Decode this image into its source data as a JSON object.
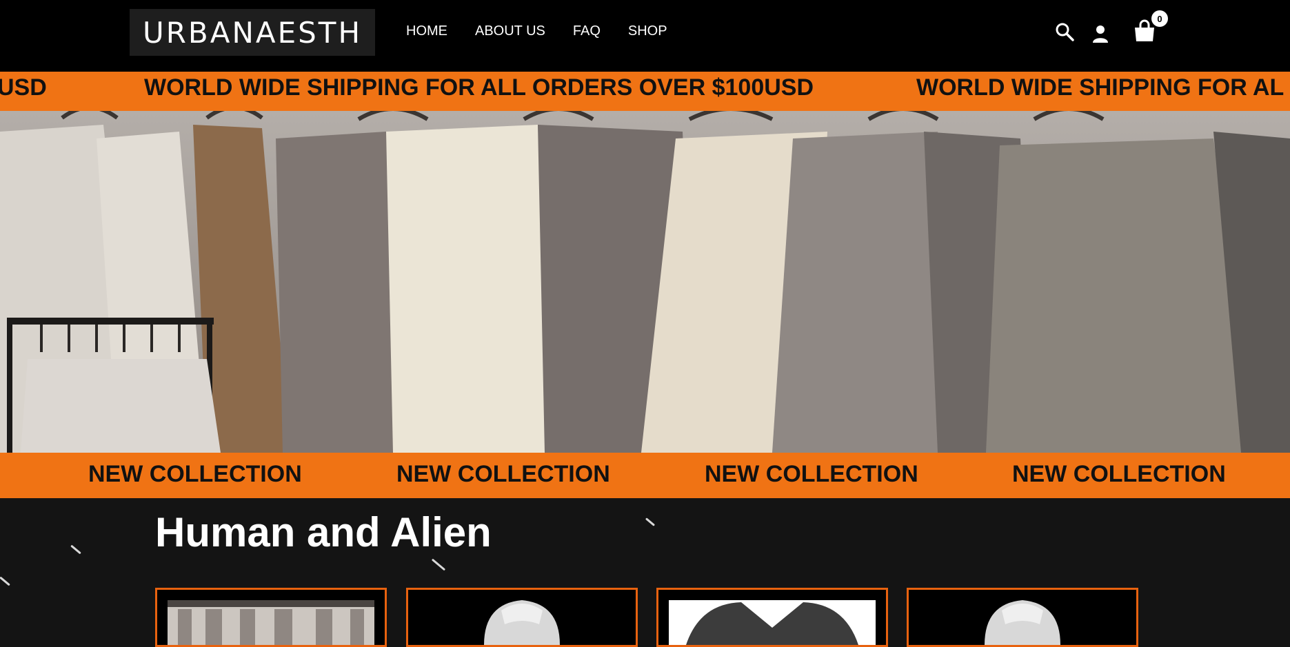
{
  "header": {
    "logo_text": "URBANAESTH",
    "nav": [
      "HOME",
      "ABOUT US",
      "FAQ",
      "SHOP"
    ],
    "cart_count": "0",
    "icons": [
      "search-icon",
      "user-icon",
      "cart-icon"
    ]
  },
  "announcement": {
    "text": "WORLD WIDE SHIPPING FOR ALL ORDERS OVER $100USD",
    "left_fragment": "USD",
    "right_fragment": "WORLD WIDE SHIPPING FOR AL"
  },
  "collection_bar": {
    "items": [
      "NEW COLLECTION",
      "NEW COLLECTION",
      "NEW COLLECTION",
      "NEW COLLECTION"
    ]
  },
  "section": {
    "title": "Human and Alien"
  },
  "colors": {
    "accent": "#f07314",
    "header_bg": "#000000",
    "page_bg": "#141414"
  }
}
